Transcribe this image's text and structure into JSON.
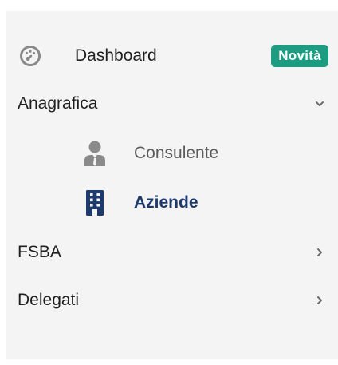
{
  "colors": {
    "sidebar_bg": "#f4f4f4",
    "text": "#1f1f1f",
    "muted": "#5c5c5c",
    "active": "#1c3a6b",
    "badge": "#1e9c82",
    "icon_grey": "#8a8a8a"
  },
  "menu": {
    "dashboard": {
      "label": "Dashboard",
      "icon": "gauge-icon",
      "badge": "Novità"
    },
    "anagrafica": {
      "label": "Anagrafica",
      "expanded": true,
      "children": [
        {
          "label": "Consulente",
          "icon": "user-tie-icon",
          "active": false
        },
        {
          "label": "Aziende",
          "icon": "building-icon",
          "active": true
        }
      ]
    },
    "fsba": {
      "label": "FSBA",
      "expanded": false
    },
    "delegati": {
      "label": "Delegati",
      "expanded": false
    }
  }
}
